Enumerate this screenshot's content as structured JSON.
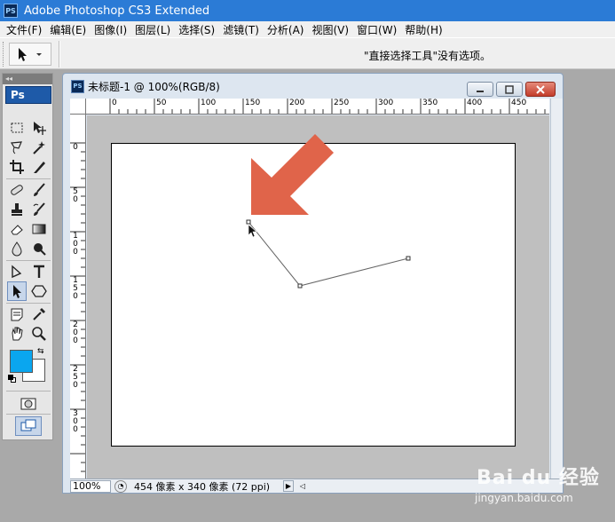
{
  "window": {
    "app_icon": "PS",
    "title": "Adobe Photoshop CS3 Extended"
  },
  "menu": [
    {
      "label": "文件(F)"
    },
    {
      "label": "编辑(E)"
    },
    {
      "label": "图像(I)"
    },
    {
      "label": "图层(L)"
    },
    {
      "label": "选择(S)"
    },
    {
      "label": "滤镜(T)"
    },
    {
      "label": "分析(A)"
    },
    {
      "label": "视图(V)"
    },
    {
      "label": "窗口(W)"
    },
    {
      "label": "帮助(H)"
    }
  ],
  "options_bar": {
    "message": "\"直接选择工具\"没有选项。",
    "current_tool_icon": "direct-selection-icon"
  },
  "toolbox": {
    "logo": "Ps",
    "active_tool": "direct-selection-tool",
    "foreground_color": "#0aa6ef",
    "background_color": "#ffffff"
  },
  "document": {
    "icon": "PS",
    "title": "未标题-1 @ 100%(RGB/8)",
    "zoom": "100%",
    "info": "454 像素 x 340 像素 (72 ppi)",
    "ruler_top_labels": [
      "0",
      "50",
      "100",
      "150",
      "200",
      "250",
      "300",
      "350",
      "400",
      "450"
    ],
    "ruler_left_labels": [
      "0",
      "50",
      "100",
      "150",
      "200",
      "250",
      "300"
    ]
  },
  "annotation": {
    "arrow_color": "#e0644a"
  },
  "watermark": {
    "brand": "Bai du 经验",
    "url": "jingyan.baidu.com"
  }
}
